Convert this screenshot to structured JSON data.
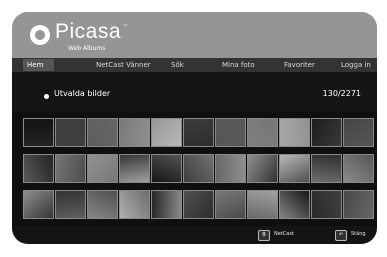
{
  "app": {
    "brand": "Picasa",
    "tagline": "Web Albums",
    "tm": "™"
  },
  "nav": [
    {
      "label": "Hem",
      "active": true
    },
    {
      "label": "NetCast Vänner",
      "active": false
    },
    {
      "label": "Sök",
      "active": false
    },
    {
      "label": "Mina foto",
      "active": false
    },
    {
      "label": "Favoriter",
      "active": false
    },
    {
      "label": "Logga in",
      "active": false
    }
  ],
  "section": {
    "title": "Utvalda bilder",
    "count": "130/2271"
  },
  "footer": {
    "left_key": "B",
    "left_label": "NetCast",
    "right_key": "↶",
    "right_label": "Stäng"
  }
}
